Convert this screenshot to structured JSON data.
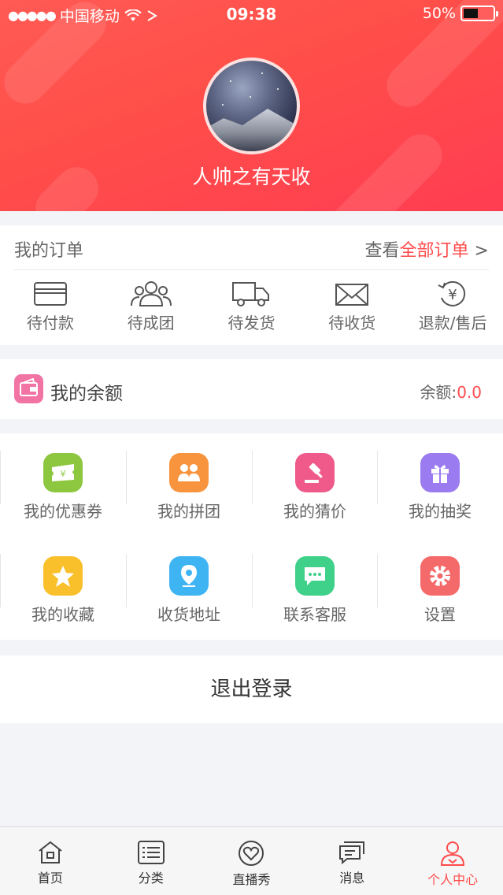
{
  "status_bar": {
    "carrier": "中国移动",
    "time": "09:38",
    "battery": "50%"
  },
  "profile": {
    "username": "人帅之有天收"
  },
  "orders": {
    "title": "我的订单",
    "view_prefix": "查看",
    "view_highlight": "全部订单",
    "view_suffix": " >",
    "items": [
      {
        "label": "待付款",
        "icon": "card-icon"
      },
      {
        "label": "待成团",
        "icon": "group-icon"
      },
      {
        "label": "待发货",
        "icon": "truck-icon"
      },
      {
        "label": "待收货",
        "icon": "envelope-icon"
      },
      {
        "label": "退款/售后",
        "icon": "refund-icon"
      }
    ]
  },
  "balance": {
    "title": "我的余额",
    "label": "余额:",
    "value": "0.0"
  },
  "services": [
    {
      "label": "我的优惠券",
      "icon": "coupon-icon",
      "color": "#8dc63f"
    },
    {
      "label": "我的拼团",
      "icon": "team-icon",
      "color": "#f7943d"
    },
    {
      "label": "我的猜价",
      "icon": "gavel-icon",
      "color": "#ef5a8a"
    },
    {
      "label": "我的抽奖",
      "icon": "gift-icon",
      "color": "#9b7bf0"
    },
    {
      "label": "我的收藏",
      "icon": "star-icon",
      "color": "#f9c02b"
    },
    {
      "label": "收货地址",
      "icon": "location-icon",
      "color": "#3fb4f2"
    },
    {
      "label": "联系客服",
      "icon": "chat-icon",
      "color": "#3fd08a"
    },
    {
      "label": "设置",
      "icon": "gear-icon",
      "color": "#f46a6a"
    }
  ],
  "logout": {
    "label": "退出登录"
  },
  "tabbar": {
    "tabs": [
      {
        "label": "首页",
        "icon": "home-icon"
      },
      {
        "label": "分类",
        "icon": "list-icon"
      },
      {
        "label": "直播秀",
        "icon": "heart-live-icon"
      },
      {
        "label": "消息",
        "icon": "message-icon"
      },
      {
        "label": "个人中心",
        "icon": "person-icon",
        "active": true
      }
    ]
  },
  "colors": {
    "brand": "#ff4b4b",
    "header_gradient_start": "#ff5a55",
    "header_gradient_end": "#ff3d52"
  }
}
